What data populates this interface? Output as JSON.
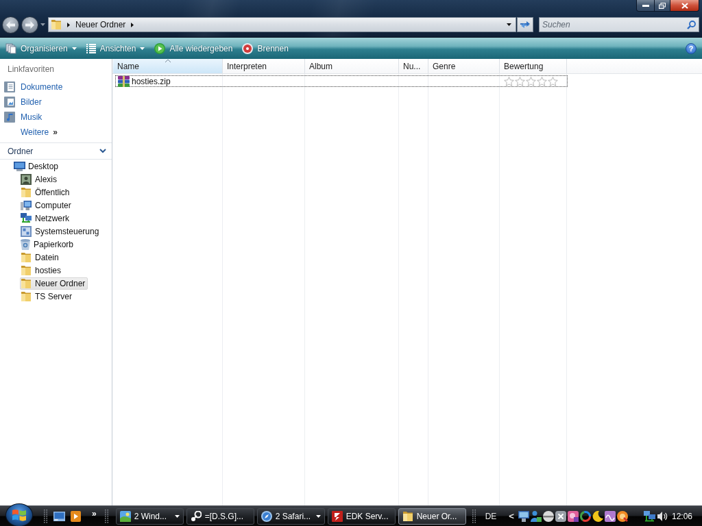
{
  "navigation": {
    "back": {
      "disabled": true
    },
    "forward": {
      "disabled": true
    },
    "address": {
      "segments": [
        "Neuer Ordner"
      ]
    },
    "search": {
      "placeholder": "Suchen"
    }
  },
  "toolbar": {
    "items": [
      {
        "label": "Organisieren",
        "kind": "menu"
      },
      {
        "label": "Ansichten",
        "kind": "menu"
      },
      {
        "label": "Alle wiedergeben",
        "kind": "action"
      },
      {
        "label": "Brennen",
        "kind": "action"
      }
    ],
    "help": "?"
  },
  "sidebar": {
    "favorites": {
      "title": "Linkfavoriten",
      "items": [
        {
          "label": "Dokumente"
        },
        {
          "label": "Bilder"
        },
        {
          "label": "Musik"
        }
      ],
      "more": "Weitere",
      "more_arrow": "»"
    },
    "folders": {
      "title": "Ordner",
      "expanded": true,
      "tree": [
        {
          "label": "Desktop",
          "kind": "desktop",
          "selected": false,
          "children": [
            {
              "label": "Alexis",
              "kind": "user",
              "selected": false
            },
            {
              "label": "Öffentlich",
              "kind": "folder",
              "selected": false
            },
            {
              "label": "Computer",
              "kind": "computer",
              "selected": false
            },
            {
              "label": "Netzwerk",
              "kind": "network",
              "selected": false
            },
            {
              "label": "Systemsteuerung",
              "kind": "controlpanel",
              "selected": false
            },
            {
              "label": "Papierkorb",
              "kind": "trash",
              "selected": false
            },
            {
              "label": "Datein",
              "kind": "folder",
              "selected": false
            },
            {
              "label": "hosties",
              "kind": "folder",
              "selected": false
            },
            {
              "label": "Neuer Ordner",
              "kind": "folder",
              "selected": true
            },
            {
              "label": "TS Server",
              "kind": "folder",
              "selected": false
            }
          ]
        }
      ]
    }
  },
  "file_list": {
    "columns": [
      {
        "label": "Name",
        "sorted": true
      },
      {
        "label": "Interpreten",
        "sorted": false
      },
      {
        "label": "Album",
        "sorted": false
      },
      {
        "label": "Nu...",
        "sorted": false
      },
      {
        "label": "Genre",
        "sorted": false
      },
      {
        "label": "Bewertung",
        "sorted": false
      }
    ],
    "rows": [
      {
        "name": "hosties.zip",
        "focused": true,
        "stars": 0
      }
    ]
  },
  "taskbar": {
    "quick_launch_more": "»",
    "tasks": [
      {
        "label": "2 Wind...",
        "grouped": true,
        "selected": false
      },
      {
        "label": "=[D.S.G]...",
        "grouped": false,
        "selected": false
      },
      {
        "label": "2 Safari...",
        "grouped": true,
        "selected": false
      },
      {
        "label": "EDK Serv...",
        "grouped": false,
        "selected": false
      },
      {
        "label": "Neuer Or...",
        "grouped": false,
        "selected": true
      }
    ],
    "language": "DE",
    "tray_expand": "<",
    "clock": "12:06"
  }
}
